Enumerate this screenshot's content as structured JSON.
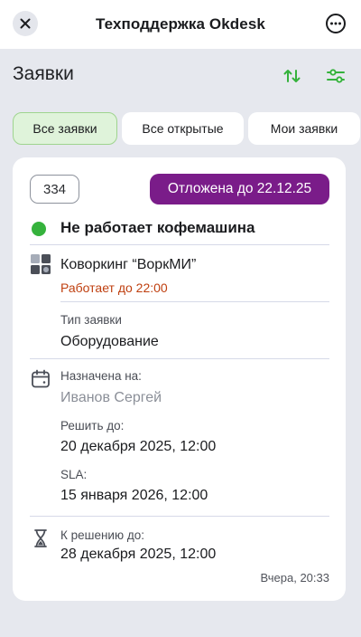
{
  "header": {
    "title": "Техподдержка Okdesk"
  },
  "page": {
    "title": "Заявки"
  },
  "tabs": [
    {
      "label": "Все заявки"
    },
    {
      "label": "Все открытые"
    },
    {
      "label": "Мои заявки"
    }
  ],
  "ticket": {
    "number": "334",
    "status": "Отложена до 22.12.25",
    "status_color": "#7a1c89",
    "priority_color": "#35b23c",
    "title": "Не работает кофемашина",
    "client": "Коворкинг “ВоркМИ”",
    "client_hours": "Работает до 22:00",
    "type_label": "Тип заявки",
    "type_value": "Оборудование",
    "assigned_label": "Назначена на:",
    "assigned_value": "Иванов Сергей",
    "due_label": "Решить до:",
    "due_value": "20 декабря 2025, 12:00",
    "sla_label": "SLA:",
    "sla_value": "15 января 2026, 12:00",
    "resolve_label": "К решению до:",
    "resolve_value": "28 декабря 2025, 12:00",
    "updated": "Вчера, 20:33"
  },
  "colors": {
    "accent": "#35b23c",
    "background": "#e6e8ee",
    "warning": "#bf3f0f"
  }
}
